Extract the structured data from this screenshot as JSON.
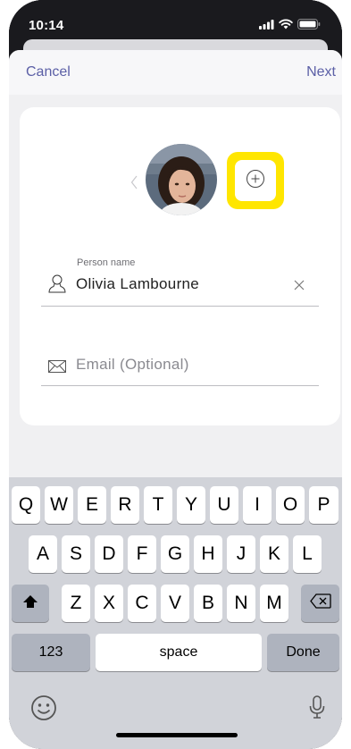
{
  "status_bar": {
    "time": "10:14"
  },
  "nav": {
    "cancel_label": "Cancel",
    "next_label": "Next"
  },
  "form": {
    "name_label": "Person name",
    "name_value": "Olivia Lambourne",
    "email_placeholder": "Email (Optional)",
    "add_highlight_color": "#FFE600"
  },
  "keyboard": {
    "row1": [
      "Q",
      "W",
      "E",
      "R",
      "T",
      "Y",
      "U",
      "I",
      "O",
      "P"
    ],
    "row2": [
      "A",
      "S",
      "D",
      "F",
      "G",
      "H",
      "J",
      "K",
      "L"
    ],
    "row3": [
      "Z",
      "X",
      "C",
      "V",
      "B",
      "N",
      "M"
    ],
    "numbers_label": "123",
    "space_label": "space",
    "done_label": "Done"
  },
  "colors": {
    "accent": "#5B5FA6"
  }
}
